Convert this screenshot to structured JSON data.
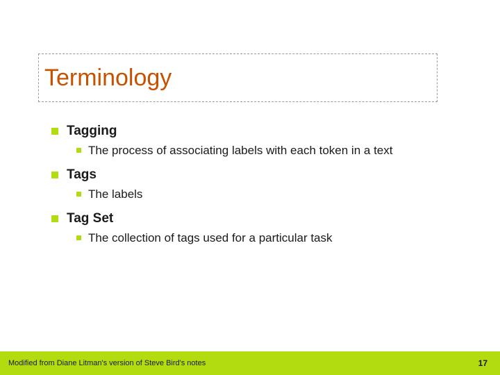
{
  "title": "Terminology",
  "items": [
    {
      "term": "Tagging",
      "def": "The process of associating labels with each token in a text"
    },
    {
      "term": "Tags",
      "def": "The labels"
    },
    {
      "term": "Tag Set",
      "def": "The collection of tags used for a particular task"
    }
  ],
  "footer": {
    "note": "Modified from Diane Litman's version of Steve Bird's notes",
    "page": "17"
  }
}
